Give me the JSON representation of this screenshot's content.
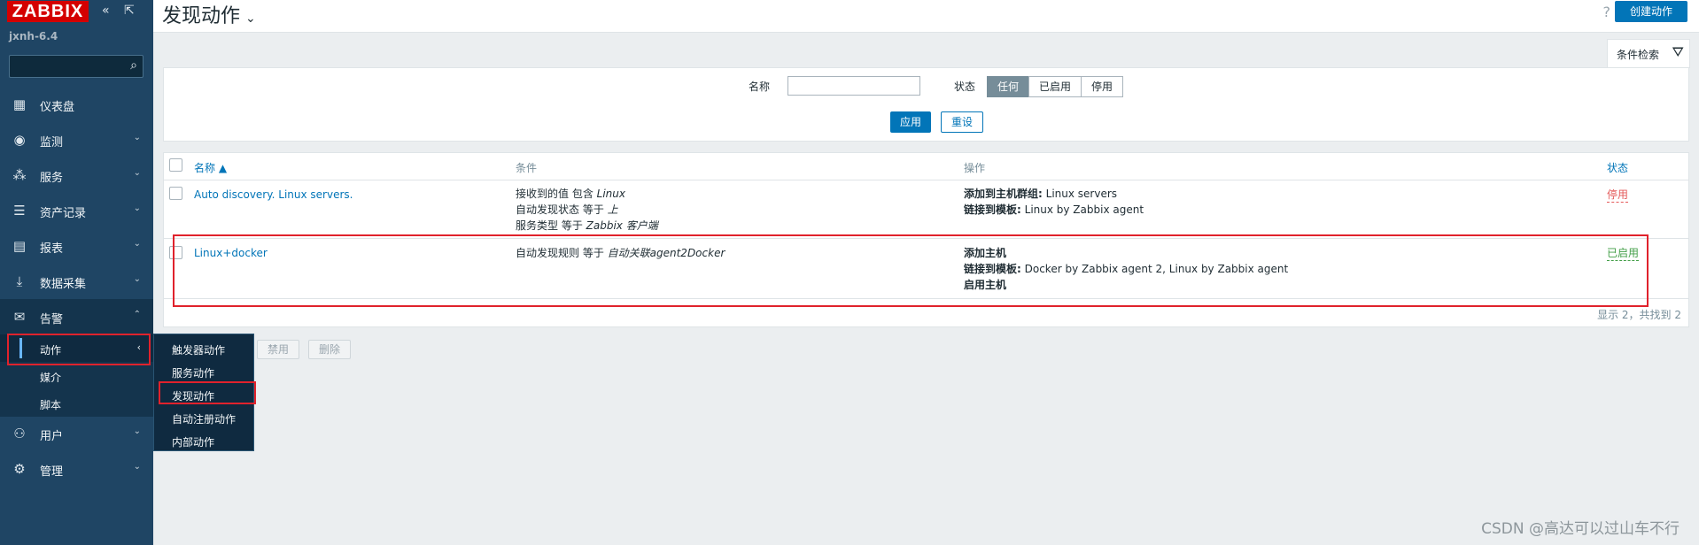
{
  "sidebar": {
    "logo": "ZABBIX",
    "collapse_icon": "double-chevron-left-icon",
    "kiosk_icon": "expand-icon",
    "hostname": "jxnh-6.4",
    "search_placeholder": "",
    "menu": [
      {
        "label": "仪表盘",
        "icon": "dashboard-icon"
      },
      {
        "label": "监测",
        "icon": "eye-icon"
      },
      {
        "label": "服务",
        "icon": "services-icon"
      },
      {
        "label": "资产记录",
        "icon": "list-icon"
      },
      {
        "label": "报表",
        "icon": "report-icon"
      },
      {
        "label": "数据采集",
        "icon": "download-icon"
      },
      {
        "label": "告警",
        "icon": "envelope-icon"
      },
      {
        "label": "用户",
        "icon": "users-icon"
      },
      {
        "label": "管理",
        "icon": "gear-icon"
      }
    ],
    "alerts_sub": [
      {
        "label": "动作"
      },
      {
        "label": "媒介"
      },
      {
        "label": "脚本"
      }
    ],
    "actions_flyout": [
      {
        "label": "触发器动作"
      },
      {
        "label": "服务动作"
      },
      {
        "label": "发现动作"
      },
      {
        "label": "自动注册动作"
      },
      {
        "label": "内部动作"
      }
    ]
  },
  "header": {
    "title": "发现动作",
    "help": "?",
    "create_button": "创建动作"
  },
  "filter": {
    "tab_label": "条件检索",
    "name_label": "名称",
    "name_value": "",
    "status_label": "状态",
    "status_options": [
      "任何",
      "已启用",
      "停用"
    ],
    "status_selected": "任何",
    "apply_button": "应用",
    "reset_button": "重设"
  },
  "table": {
    "columns": {
      "name": "名称 ▲",
      "conditions": "条件",
      "operations": "操作",
      "status": "状态"
    },
    "rows": [
      {
        "name": "Auto discovery. Linux servers.",
        "conditions": [
          {
            "text": "接收到的值 包含 ",
            "value": "Linux"
          },
          {
            "text": "自动发现状态 等于 ",
            "value": "上"
          },
          {
            "text": "服务类型 等于 ",
            "value": "Zabbix 客户端"
          }
        ],
        "operations": [
          {
            "label": "添加到主机群组:",
            "value": " Linux servers"
          },
          {
            "label": "链接到模板:",
            "value": " Linux by Zabbix agent"
          }
        ],
        "status": "停用"
      },
      {
        "name": "Linux+docker",
        "conditions": [
          {
            "text": "自动发现规则 等于 ",
            "value": "自动关联agent2Docker"
          }
        ],
        "operations": [
          {
            "label": "添加主机",
            "value": ""
          },
          {
            "label": "链接到模板:",
            "value": " Docker by Zabbix agent 2, Linux by Zabbix agent"
          },
          {
            "label": "启用主机",
            "value": ""
          }
        ],
        "status": "已启用"
      }
    ],
    "footer": "显示 2，共找到 2"
  },
  "mass_actions": {
    "disable": "禁用",
    "delete": "删除"
  },
  "watermark": "CSDN @高达可以过山车不行",
  "colors": {
    "accent": "#0275b8",
    "sidebar": "#1f4564",
    "enabled": "#429e47",
    "disabled": "#e45959",
    "highlight": "#e0222c"
  }
}
